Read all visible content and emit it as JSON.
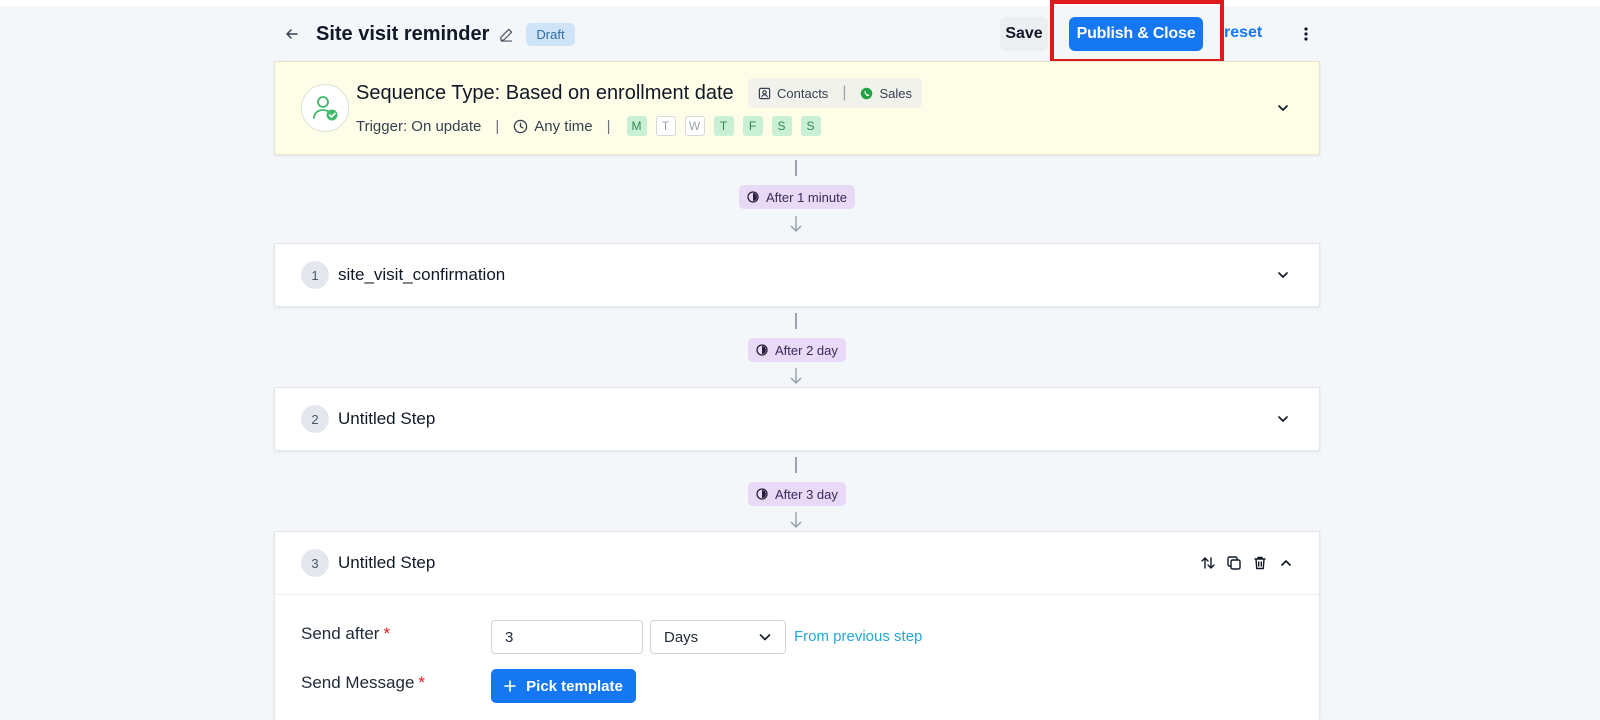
{
  "header": {
    "title": "Site visit reminder",
    "status_badge": "Draft",
    "save_label": "Save",
    "publish_label": "Publish & Close",
    "preset_label": "reset"
  },
  "trigger": {
    "sequence_type": "Sequence Type: Based on enrollment date",
    "objects": [
      "Contacts",
      "Sales"
    ],
    "trigger_text": "Trigger: On update",
    "time_text": "Any time",
    "days": [
      {
        "label": "M",
        "active": true
      },
      {
        "label": "T",
        "active": false
      },
      {
        "label": "W",
        "active": false
      },
      {
        "label": "T",
        "active": true
      },
      {
        "label": "F",
        "active": true
      },
      {
        "label": "S",
        "active": true
      },
      {
        "label": "S",
        "active": true
      }
    ]
  },
  "delays": [
    {
      "label": "After 1 minute"
    },
    {
      "label": "After 2 day"
    },
    {
      "label": "After 3 day"
    }
  ],
  "steps": [
    {
      "number": "1",
      "title": "site_visit_confirmation",
      "expanded": false
    },
    {
      "number": "2",
      "title": "Untitled Step",
      "expanded": false
    },
    {
      "number": "3",
      "title": "Untitled Step",
      "expanded": true
    }
  ],
  "step3_form": {
    "send_after_label": "Send after",
    "send_after_value": "3",
    "unit_value": "Days",
    "from_previous": "From previous step",
    "send_message_label": "Send Message",
    "pick_template_label": "Pick template",
    "required_mark": "*"
  },
  "colors": {
    "primary": "#1577f2",
    "highlight": "#e0191d",
    "trigger_bg": "#fdfde8",
    "delay_badge_bg": "#e8d9f7",
    "day_active_bg": "#c9efd4"
  }
}
